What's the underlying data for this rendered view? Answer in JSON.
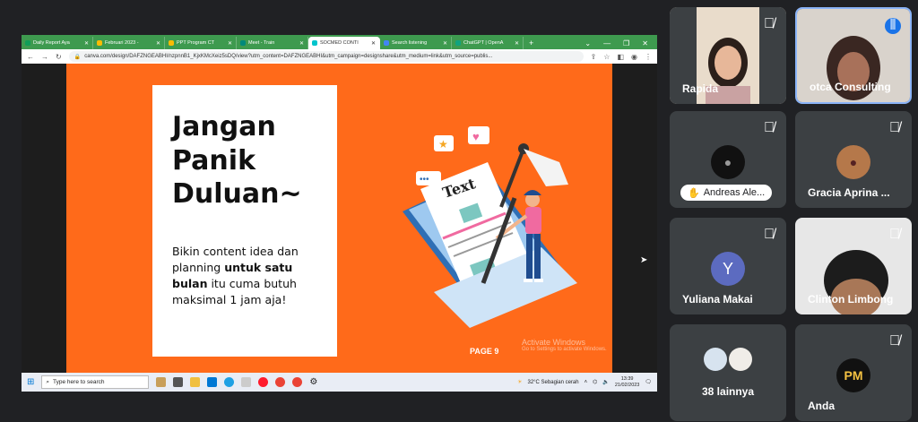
{
  "browser": {
    "tabs": [
      {
        "label": "Daily Report Aya",
        "color": "#0f9d58"
      },
      {
        "label": "Februari 2023 -",
        "color": "#fbbc04"
      },
      {
        "label": "PPT Program CT",
        "color": "#fbbc04"
      },
      {
        "label": "Meet - Train",
        "color": "#00897b"
      },
      {
        "label": "SOCMED CONTI",
        "color": "#00c4cc"
      },
      {
        "label": "Search listening",
        "color": "#4285f4"
      },
      {
        "label": "ChatGPT | OpenA",
        "color": "#10a37f"
      }
    ],
    "url": "canva.com/design/DAFZNGEABHI/nzpnnB1_KjxKMcXeiz5sDQ/view?utm_content=DAFZNGEABHI&utm_campaign=designshare&utm_medium=link&utm_source=publis..."
  },
  "slide": {
    "headline": "Jangan Panik Duluan~",
    "body_pre": "Bikin content idea dan planning ",
    "body_bold": "untuk satu bulan",
    "body_post": " itu cuma butuh maksimal 1 jam aja!",
    "illustration_text": "Text",
    "page_label": "PAGE 9",
    "watermark_title": "Activate Windows",
    "watermark_sub": "Go to Settings to activate Windows."
  },
  "taskbar": {
    "search_placeholder": "Type here to search",
    "weather": "32°C  Sebagian cerah",
    "time": "13:39",
    "date": "21/02/2023"
  },
  "participants": [
    {
      "name": "Rapida",
      "type": "video",
      "muted": true
    },
    {
      "name": "otca Consulting",
      "type": "video",
      "muted": false,
      "speaking": true
    },
    {
      "name": "Andreas Ale...",
      "type": "avatar",
      "muted": true,
      "pinned_label": true
    },
    {
      "name": "Gracia Aprina ...",
      "type": "avatar",
      "muted": true
    },
    {
      "name": "Yuliana Makai",
      "type": "letter",
      "letter": "Y",
      "color": "#5c6bc0",
      "muted": true
    },
    {
      "name": "Clinton Limbong",
      "type": "video",
      "muted": true
    },
    {
      "name": "38 lainnya",
      "type": "group"
    },
    {
      "name": "Anda",
      "type": "logo",
      "letter": "PM",
      "muted": true
    }
  ]
}
